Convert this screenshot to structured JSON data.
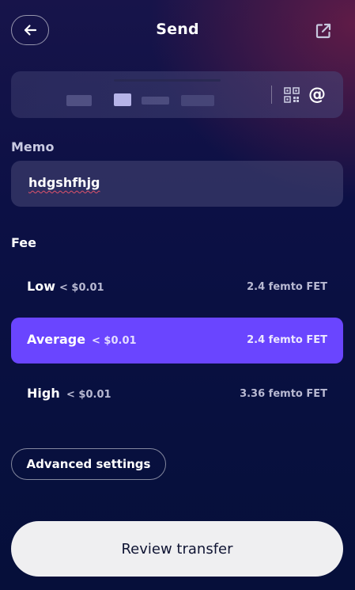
{
  "header": {
    "title": "Send",
    "back_icon": "arrow-left-icon",
    "external_icon": "external-link-icon"
  },
  "recipient": {
    "qr_icon": "qr-code-icon",
    "at_symbol": "@"
  },
  "memo": {
    "label": "Memo",
    "value": "hdgshfhjg"
  },
  "fee": {
    "label": "Fee",
    "options": [
      {
        "name": "Low",
        "usd": "< $0.01",
        "amount": "2.4 femto FET",
        "selected": false
      },
      {
        "name": "Average",
        "usd": "< $0.01",
        "amount": "2.4 femto FET",
        "selected": true
      },
      {
        "name": "High",
        "usd": "< $0.01",
        "amount": "3.36 femto FET",
        "selected": false
      }
    ]
  },
  "advanced_settings_label": "Advanced settings",
  "review_button_label": "Review transfer",
  "colors": {
    "accent": "#6a45ff",
    "background": "#0c1045",
    "button_light": "#efeff1"
  }
}
